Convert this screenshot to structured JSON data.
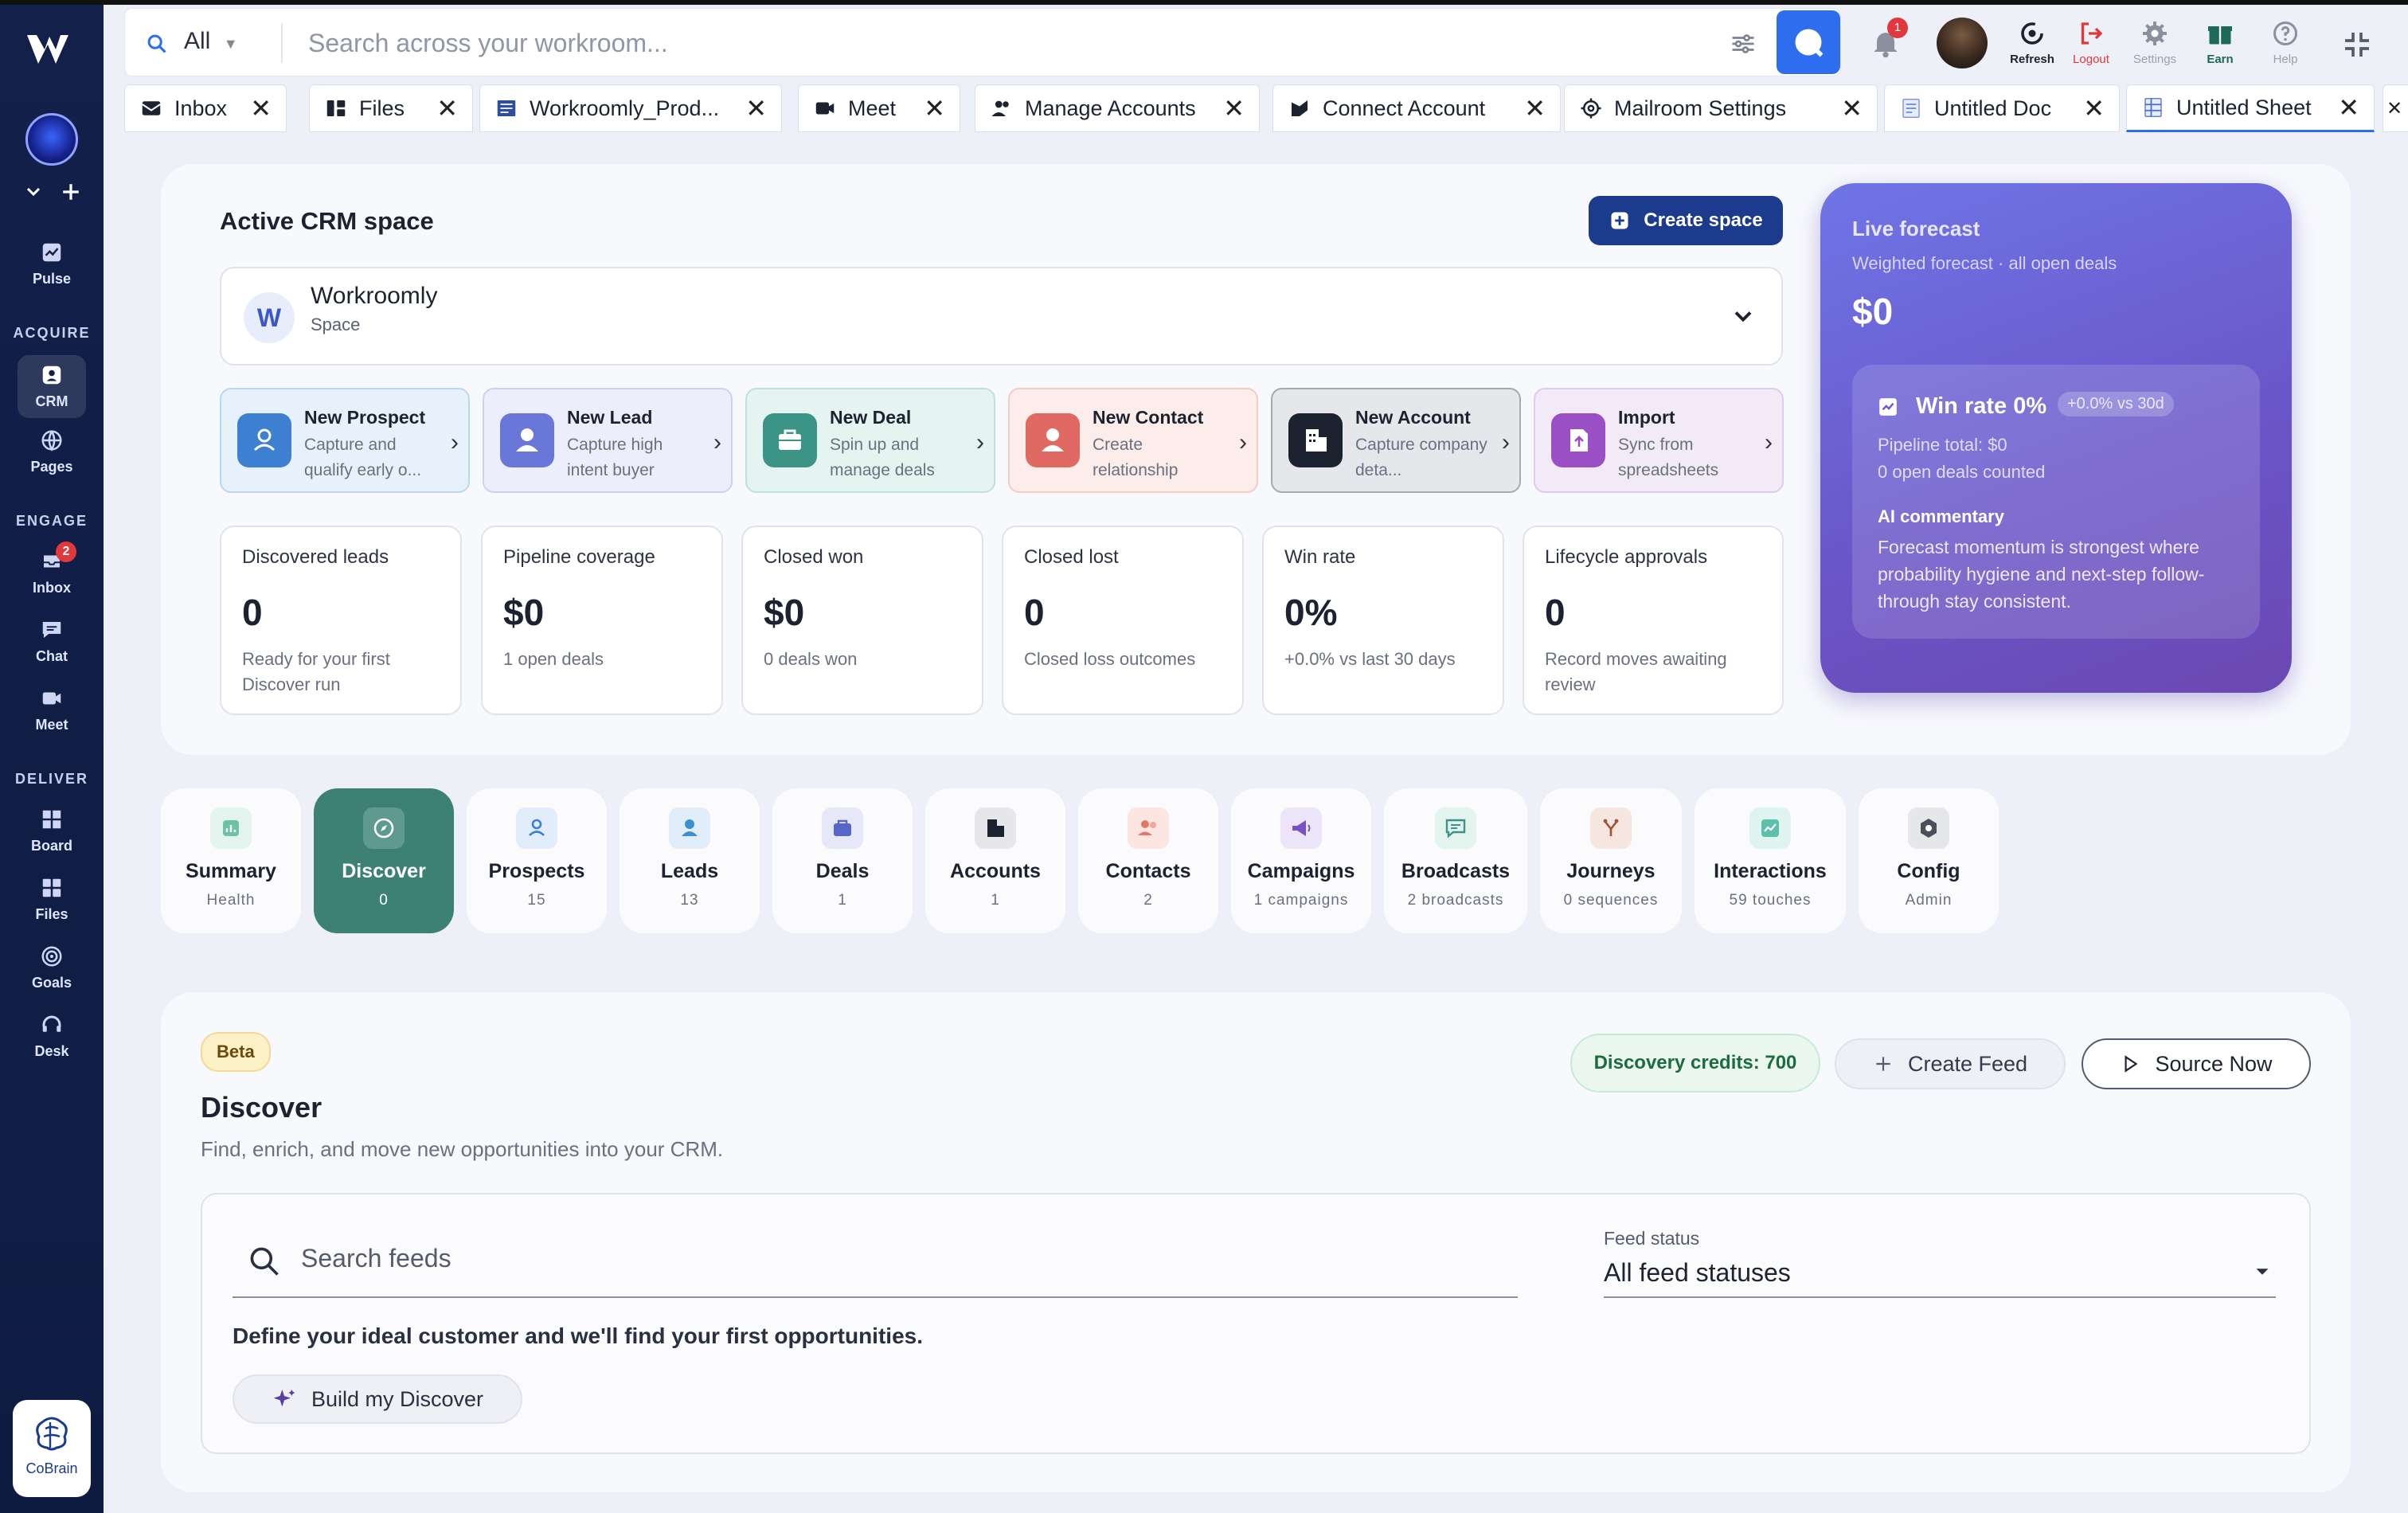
{
  "search": {
    "scope": "All",
    "placeholder": "Search across your workroom..."
  },
  "topbar": {
    "notifications_count": "1",
    "actions": [
      {
        "label": "Refresh",
        "color": "#1d2230"
      },
      {
        "label": "Logout",
        "color": "#e0383b"
      },
      {
        "label": "Settings",
        "color": "#9aa0ae"
      },
      {
        "label": "Earn",
        "color": "#1c6b5a"
      },
      {
        "label": "Help",
        "color": "#9aa0ae"
      }
    ]
  },
  "tabs": [
    {
      "label": "Inbox",
      "icon": "inbox-icon"
    },
    {
      "label": "Files",
      "icon": "files-icon"
    },
    {
      "label": "Workroomly_Prod...",
      "icon": "document-icon"
    },
    {
      "label": "Meet",
      "icon": "video-icon"
    },
    {
      "label": "Manage Accounts",
      "icon": "users-icon"
    },
    {
      "label": "Connect Account",
      "icon": "connect-icon"
    },
    {
      "label": "Mailroom Settings",
      "icon": "gear-icon"
    },
    {
      "label": "Untitled Doc",
      "icon": "doc-icon"
    },
    {
      "label": "Untitled Sheet",
      "icon": "sheet-icon"
    }
  ],
  "sidebar": {
    "pulse": "Pulse",
    "acquire": "ACQUIRE",
    "crm": "CRM",
    "pages": "Pages",
    "engage": "ENGAGE",
    "inbox": "Inbox",
    "inbox_badge": "2",
    "chat": "Chat",
    "meet": "Meet",
    "deliver": "DELIVER",
    "board": "Board",
    "files": "Files",
    "goals": "Goals",
    "desk": "Desk",
    "cobrain": "CoBrain"
  },
  "crm": {
    "title": "Active CRM space",
    "create_space": "Create space",
    "space_initial": "W",
    "space_name": "Workroomly",
    "space_sub": "Space"
  },
  "quick_actions": [
    {
      "title": "New Prospect",
      "sub": "Capture and qualify early o...",
      "color": "#3d7fd0",
      "bg": "#e6f1fb",
      "border": "#b9d8f2"
    },
    {
      "title": "New Lead",
      "sub": "Capture high intent buyer",
      "color": "#6977d8",
      "bg": "#eceefb",
      "border": "#cdd2f3"
    },
    {
      "title": "New Deal",
      "sub": "Spin up and manage deals",
      "color": "#3c9486",
      "bg": "#e6f4f1",
      "border": "#bfe1d9"
    },
    {
      "title": "New Contact",
      "sub": "Create relationship",
      "color": "#e06a63",
      "bg": "#fcecea",
      "border": "#f3cbc7"
    },
    {
      "title": "New Account",
      "sub": "Capture company deta...",
      "color": "#1d2230",
      "bg": "#e6e7eb",
      "border": "#a6a9b3"
    },
    {
      "title": "Import",
      "sub": "Sync from spreadsheets",
      "color": "#9b4fc4",
      "bg": "#f3eaf8",
      "border": "#dfcbeb"
    }
  ],
  "stats": [
    {
      "label": "Discovered leads",
      "value": "0",
      "sub": "Ready for your first Discover run"
    },
    {
      "label": "Pipeline coverage",
      "value": "$0",
      "sub": "1 open deals"
    },
    {
      "label": "Closed won",
      "value": "$0",
      "sub": "0 deals won"
    },
    {
      "label": "Closed lost",
      "value": "0",
      "sub": "Closed loss outcomes"
    },
    {
      "label": "Win rate",
      "value": "0%",
      "sub": "+0.0% vs last 30 days"
    },
    {
      "label": "Lifecycle approvals",
      "value": "0",
      "sub": "Record moves awaiting review"
    }
  ],
  "forecast": {
    "title": "Live forecast",
    "sub": "Weighted forecast · all open deals",
    "value": "$0",
    "win_rate": "Win rate 0%",
    "win_rate_delta": "+0.0% vs 30d",
    "pipeline_total": "Pipeline total: $0",
    "open_deals": "0 open deals counted",
    "ai_heading": "AI commentary",
    "ai_text": "Forecast momentum is strongest where probability hygiene and next-step follow-through stay consistent."
  },
  "modules": [
    {
      "name": "Summary",
      "count": "Health",
      "color": "#3c9486",
      "bg": "#e3f3ee"
    },
    {
      "name": "Discover",
      "count": "0",
      "color": "#ffffff",
      "bg": "#5e9a8f"
    },
    {
      "name": "Prospects",
      "count": "15",
      "color": "#3d7fd0",
      "bg": "#e1edfa"
    },
    {
      "name": "Leads",
      "count": "13",
      "color": "#3d8fd0",
      "bg": "#e1eefa"
    },
    {
      "name": "Deals",
      "count": "1",
      "color": "#5865c8",
      "bg": "#e6e8f8"
    },
    {
      "name": "Accounts",
      "count": "1",
      "color": "#1d2230",
      "bg": "#e6e7eb"
    },
    {
      "name": "Contacts",
      "count": "2",
      "color": "#e07a66",
      "bg": "#fbe6e1"
    },
    {
      "name": "Campaigns",
      "count": "1 campaigns",
      "color": "#7a52c8",
      "bg": "#ece5f8"
    },
    {
      "name": "Broadcasts",
      "count": "2 broadcasts",
      "color": "#3c9486",
      "bg": "#e3f3ee"
    },
    {
      "name": "Journeys",
      "count": "0 sequences",
      "color": "#a0533a",
      "bg": "#f6e6e0"
    },
    {
      "name": "Interactions",
      "count": "59 touches",
      "color": "#3ca08f",
      "bg": "#e0f4ef"
    },
    {
      "name": "Config",
      "count": "Admin",
      "color": "#4a4f5c",
      "bg": "#e6e7eb"
    }
  ],
  "discover": {
    "beta": "Beta",
    "title": "Discover",
    "subtitle": "Find, enrich, and move new opportunities into your CRM.",
    "credits": "Discovery credits: 700",
    "create_feed": "Create Feed",
    "source_now": "Source Now",
    "search_placeholder": "Search feeds",
    "status_label": "Feed status",
    "status_value": "All feed statuses",
    "define_text": "Define your ideal customer and we'll find your first opportunities.",
    "build_button": "Build my Discover"
  }
}
